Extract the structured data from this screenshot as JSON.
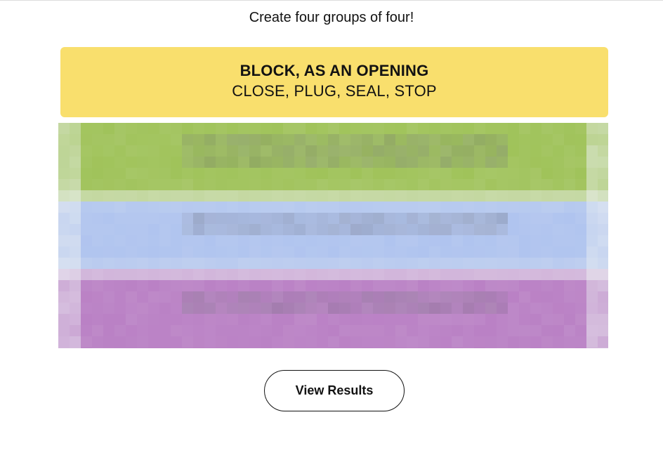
{
  "instructions": "Create four groups of four!",
  "solved_groups": [
    {
      "title": "BLOCK, AS AN OPENING",
      "members": "CLOSE, PLUG, SEAL, STOP",
      "color": "#f9df6d"
    }
  ],
  "obscured_group_colors": [
    "#a0c35a",
    "#b0c4ef",
    "#ba81c5"
  ],
  "view_results_label": "View Results"
}
